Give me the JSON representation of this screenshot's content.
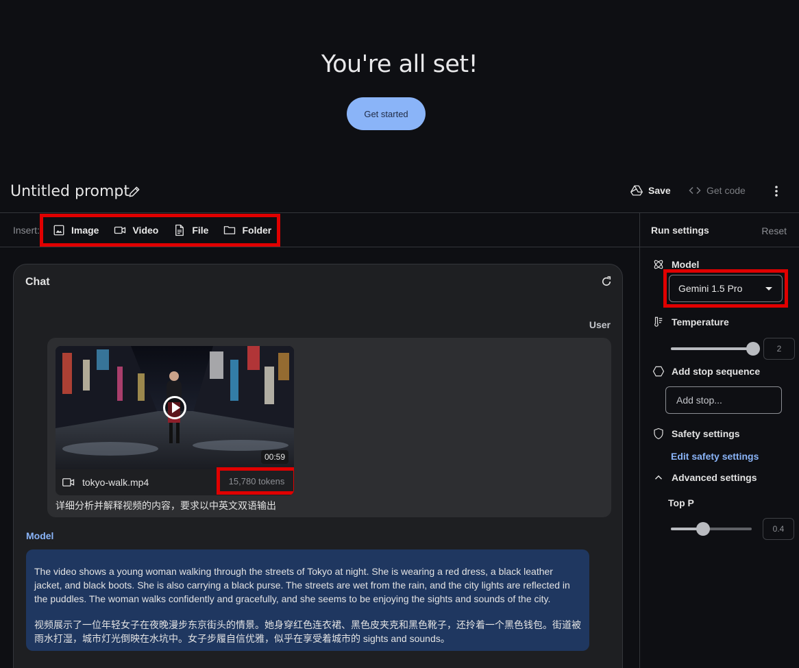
{
  "hero": {
    "title": "You're all set!",
    "button": "Get started"
  },
  "header": {
    "title": "Untitled prompt",
    "save": "Save",
    "get_code": "Get code"
  },
  "insert": {
    "label": "Insert:",
    "items": [
      {
        "label": "Image",
        "icon": "image-icon"
      },
      {
        "label": "Video",
        "icon": "video-icon"
      },
      {
        "label": "File",
        "icon": "file-icon"
      },
      {
        "label": "Folder",
        "icon": "folder-icon"
      }
    ]
  },
  "run_settings": {
    "title": "Run settings",
    "reset": "Reset",
    "model_label": "Model",
    "model_value": "Gemini 1.5 Pro",
    "temperature_label": "Temperature",
    "temperature_value": "2",
    "temperature_fraction": 1.0,
    "stop_label": "Add stop sequence",
    "stop_placeholder": "Add stop...",
    "safety_label": "Safety settings",
    "edit_safety": "Edit safety settings",
    "advanced_label": "Advanced settings",
    "top_p_label": "Top P",
    "top_p_value": "0.4",
    "top_p_fraction": 0.4
  },
  "chat": {
    "title": "Chat",
    "user_role": "User",
    "attachment": {
      "file_name": "tokyo-walk.mp4",
      "duration": "00:59",
      "tokens": "15,780 tokens"
    },
    "user_text": "详细分析并解释视频的内容，要求以中英文双语输出",
    "model_role": "Model",
    "model_text_en": "The video shows a young woman walking through the streets of Tokyo at night. She is wearing a red dress, a black leather jacket, and black boots. She is also carrying a black purse. The streets are wet from the rain, and the city lights are reflected in the puddles. The woman walks confidently and gracefully, and she seems to be enjoying the sights and sounds of the city.",
    "model_text_zh": "视频展示了一位年轻女子在夜晚漫步东京街头的情景。她身穿红色连衣裙、黑色皮夹克和黑色靴子，还拎着一个黑色钱包。街道被雨水打湿，城市灯光倒映在水坑中。女子步履自信优雅，似乎在享受着城市的 sights and sounds。"
  },
  "colors": {
    "accent": "#8ab4f8",
    "highlight": "#e00000",
    "model_bubble": "#1f3760",
    "background": "#0e0f13"
  }
}
